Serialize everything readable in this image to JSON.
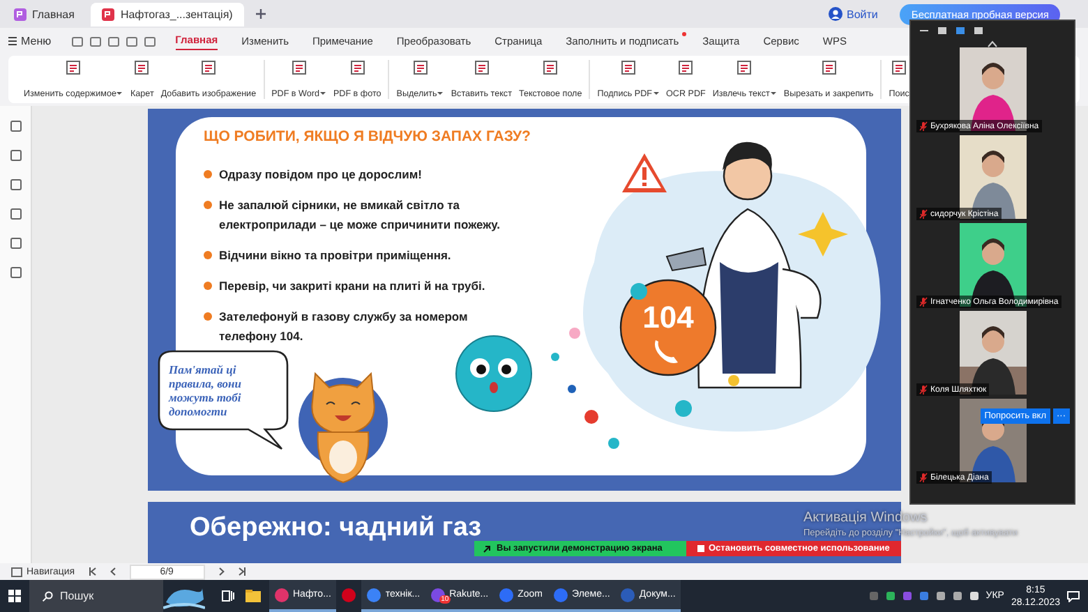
{
  "browser_tabs": [
    {
      "label": "Главная",
      "selected": false
    },
    {
      "label": "Нафтогаз_...зентація)",
      "selected": true
    }
  ],
  "account": {
    "login": "Войти",
    "trial_button": "Бесплатная пробная версия"
  },
  "menu_button": "Меню",
  "ribbon_tabs": [
    {
      "label": "Главная",
      "selected": true,
      "badge": false
    },
    {
      "label": "Изменить",
      "selected": false,
      "badge": false
    },
    {
      "label": "Примечание",
      "selected": false,
      "badge": false
    },
    {
      "label": "Преобразовать",
      "selected": false,
      "badge": false
    },
    {
      "label": "Страница",
      "selected": false,
      "badge": false
    },
    {
      "label": "Заполнить и подписать",
      "selected": false,
      "badge": true
    },
    {
      "label": "Защита",
      "selected": false,
      "badge": false
    },
    {
      "label": "Сервис",
      "selected": false,
      "badge": false
    },
    {
      "label": "WPS",
      "selected": false,
      "badge": false
    }
  ],
  "tool_groups": [
    [
      {
        "label": "Изменить содержимое",
        "dropdown": true
      },
      {
        "label": "Карет",
        "dropdown": false
      },
      {
        "label": "Добавить изображение",
        "dropdown": false
      }
    ],
    [
      {
        "label": "PDF в Word",
        "dropdown": true
      },
      {
        "label": "PDF в фото",
        "dropdown": false
      }
    ],
    [
      {
        "label": "Выделить",
        "dropdown": true
      },
      {
        "label": "Вставить текст",
        "dropdown": false
      },
      {
        "label": "Текстовое поле",
        "dropdown": false
      }
    ],
    [
      {
        "label": "Подпись PDF",
        "dropdown": true
      },
      {
        "label": "OCR PDF",
        "dropdown": false
      },
      {
        "label": "Извлечь текст",
        "dropdown": true
      },
      {
        "label": "Вырезать и закрепить",
        "dropdown": false
      }
    ],
    [
      {
        "label": "Поис",
        "dropdown": false
      }
    ]
  ],
  "slide": {
    "title": "ЩО РОБИТИ, ЯКЩО Я ВІДЧУЮ ЗАПАХ ГАЗУ?",
    "bullets": [
      "Одразу повідом про це дорослим!",
      "Не запалюй сірники, не вмикай світло та електроприлади – це може спричинити пожежу.",
      "Відчини вікно та провітри приміщення.",
      "Перевір, чи закриті крани на плиті й на трубі.",
      "Зателефонуй в газову службу за номером телефону 104."
    ],
    "speech_bubble": "Пам'ятай ці правила, вони можуть тобі допомогти",
    "phone_number": "104"
  },
  "next_slide": {
    "title": "Обережно: чадний газ"
  },
  "share_bar": {
    "status": "Вы запустили демонстрацию экрана",
    "stop_button": "Остановить совместное использование"
  },
  "activation_notice": {
    "title": "Активація Windows",
    "text": "Перейдіть до розділу \"Настройки\", щоб активувати"
  },
  "status_bar": {
    "navigation": "Навигация",
    "page_field": "6/9"
  },
  "video_panel": {
    "participants": [
      {
        "name": "Бухрякова Аліна Олексіївна",
        "muted": true
      },
      {
        "name": "сидорчук Крістіна",
        "muted": true
      },
      {
        "name": "Ігнатченко Ольга Володимирівна",
        "muted": true
      },
      {
        "name": "Коля Шляхтюк",
        "muted": true
      },
      {
        "name": "Білецька Діана",
        "muted": true
      }
    ],
    "ask_button": "Попросить вкл",
    "more_button": "···"
  },
  "taskbar": {
    "search_placeholder": "Пошук",
    "apps": [
      {
        "label": "Нафто...",
        "active": true
      },
      {
        "active": false
      },
      {
        "label": "технік...",
        "active": true
      },
      {
        "label": "Rakute...",
        "active": true,
        "badge": "10"
      },
      {
        "label": "Zoom",
        "active": true
      },
      {
        "label": "Элеме...",
        "active": true
      },
      {
        "label": "Докум...",
        "active": true
      }
    ],
    "language": "УКР",
    "time": "8:15",
    "date": "28.12.2023"
  }
}
